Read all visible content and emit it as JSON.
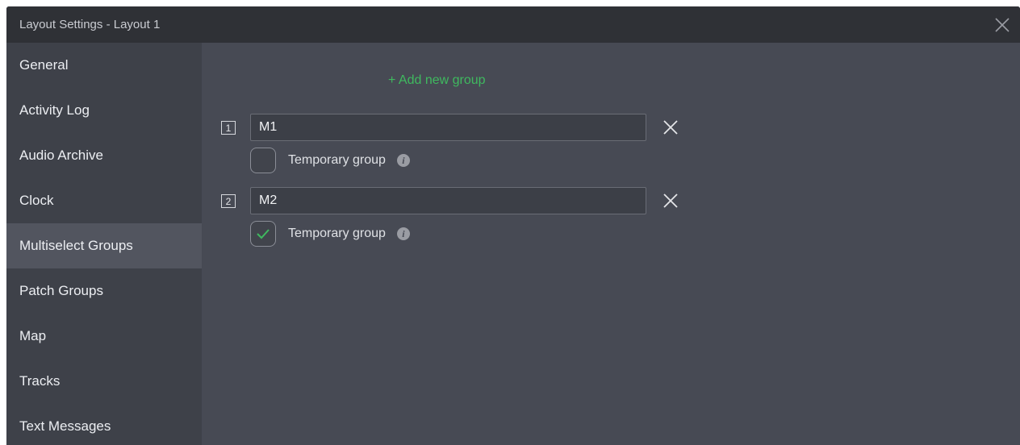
{
  "window": {
    "title": "Layout Settings - Layout 1",
    "close_icon": "close-icon"
  },
  "sidebar": {
    "items": [
      {
        "label": "General"
      },
      {
        "label": "Activity Log"
      },
      {
        "label": "Audio Archive"
      },
      {
        "label": "Clock"
      },
      {
        "label": "Multiselect Groups",
        "active": true
      },
      {
        "label": "Patch Groups"
      },
      {
        "label": "Map"
      },
      {
        "label": "Tracks"
      },
      {
        "label": "Text Messages"
      }
    ]
  },
  "main": {
    "add_group_label": "+ Add new group",
    "groups": [
      {
        "number": "1",
        "name": "M1",
        "temporary_label": "Temporary group",
        "temporary_checked": false
      },
      {
        "number": "2",
        "name": "M2",
        "temporary_label": "Temporary group",
        "temporary_checked": true
      }
    ]
  },
  "colors": {
    "accent_green": "#3fb95f",
    "titlebar": "#2f3136",
    "sidebar": "#3e4149",
    "content": "#474a54"
  }
}
